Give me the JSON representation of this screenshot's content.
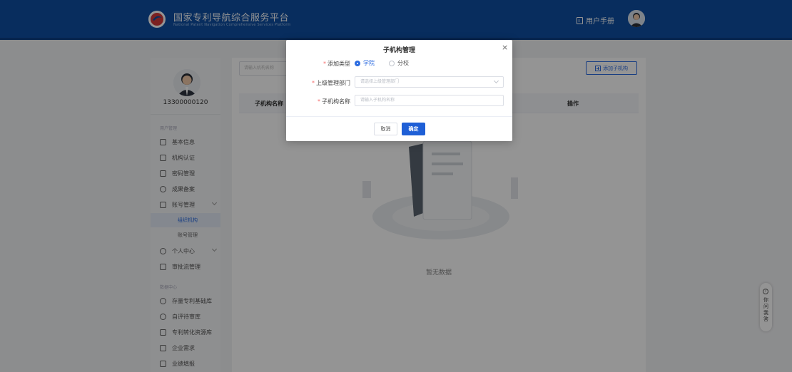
{
  "header": {
    "title": "国家专利导航综合服务平台",
    "subtitle": "National Patent Navigation Comprehensive Services Platform",
    "manual_label": "用户手册"
  },
  "sidebar": {
    "phone": "13300000120",
    "group1_title": "用户管理",
    "items": [
      {
        "label": "基本信息",
        "icon": "profile-icon"
      },
      {
        "label": "机构认证",
        "icon": "certificate-icon"
      },
      {
        "label": "密码管理",
        "icon": "lock-icon"
      },
      {
        "label": "成果备案",
        "icon": "trophy-icon"
      },
      {
        "label": "账号管理",
        "icon": "monitor-icon"
      }
    ],
    "sub_items": [
      {
        "label": "组织机构",
        "active": true
      },
      {
        "label": "账号管理",
        "active": false
      }
    ],
    "items2": [
      {
        "label": "个人中心",
        "icon": "user-circle-icon"
      },
      {
        "label": "审批流管理",
        "icon": "approval-icon"
      }
    ],
    "group2_title": "数据中心",
    "items3": [
      {
        "label": "存量专利基础库",
        "icon": "database-icon"
      },
      {
        "label": "自评待审库",
        "icon": "review-icon"
      },
      {
        "label": "专利转化资源库",
        "icon": "resource-icon"
      },
      {
        "label": "企业需求",
        "icon": "enterprise-icon"
      },
      {
        "label": "业绩填报",
        "icon": "report-icon"
      }
    ]
  },
  "main": {
    "search_placeholder": "请输入机构名称",
    "add_button": "添加子机构",
    "columns": [
      "子机构名称",
      "操作"
    ],
    "empty_text": "暂无数据"
  },
  "dialog": {
    "title": "子机构管理",
    "close": "×",
    "type_label": "添加类型",
    "radio_college": "学院",
    "radio_branch": "分校",
    "parent_label": "上级管理部门",
    "parent_placeholder": "请选择上级管理部门",
    "name_label": "子机构名称",
    "name_placeholder": "请输入子机构名称",
    "cancel": "取消",
    "confirm": "确定"
  },
  "float_help": {
    "label": "你问我答"
  },
  "colors": {
    "header_bg": "#0f4fa3",
    "primary": "#2b6be0",
    "required": "#f56c6c"
  }
}
